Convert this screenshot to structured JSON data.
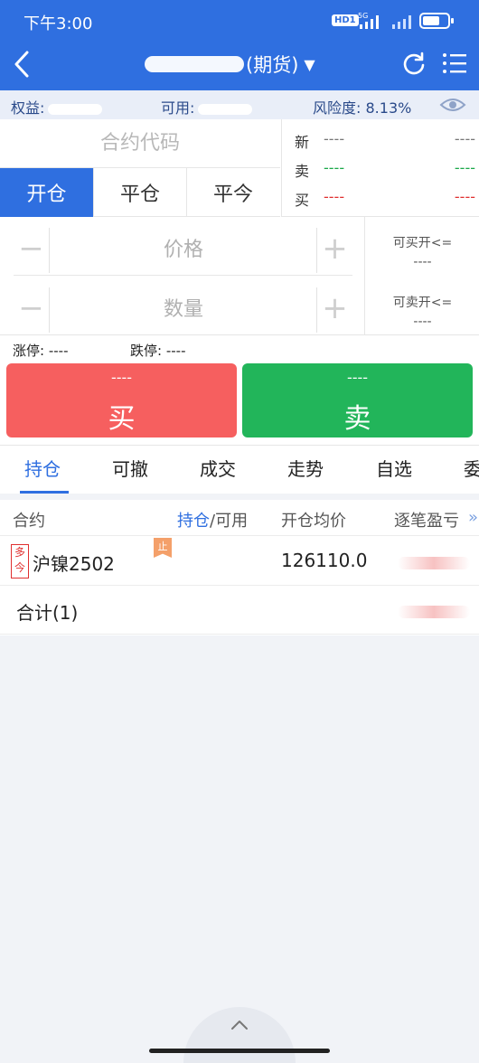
{
  "status": {
    "time": "下午3:00",
    "hd": "HD1",
    "net": "5G",
    "battery_level": 0.7
  },
  "header": {
    "title_suffix": "(期货)"
  },
  "account": {
    "equity_label": "权益:",
    "available_label": "可用:",
    "risk_label": "风险度:",
    "risk_value": "8.13%"
  },
  "order": {
    "code_placeholder": "合约代码",
    "tabs": [
      "开仓",
      "平仓",
      "平今"
    ],
    "price_placeholder": "价格",
    "qty_placeholder": "数量",
    "minus": "−",
    "plus": "+",
    "can_buy_label": "可买开<=",
    "can_buy_value": "----",
    "can_sell_label": "可卖开<=",
    "can_sell_value": "----",
    "limit_up_label": "涨停:",
    "limit_up_value": "----",
    "limit_down_label": "跌停:",
    "limit_down_value": "----",
    "buy_price": "----",
    "buy_label": "买",
    "sell_price": "----",
    "sell_label": "卖"
  },
  "quote": {
    "rows": [
      {
        "label": "新",
        "v1": "----",
        "v2": "----",
        "color": "gray"
      },
      {
        "label": "卖",
        "v1": "----",
        "v2": "----",
        "color": "green"
      },
      {
        "label": "买",
        "v1": "----",
        "v2": "----",
        "color": "red"
      }
    ]
  },
  "tabs": [
    "持仓",
    "可撤",
    "成交",
    "走势",
    "自选",
    "委"
  ],
  "positions": {
    "headers": {
      "contract": "合约",
      "holding": "持仓",
      "holding_sep": "/可用",
      "avg_price": "开仓均价",
      "pnl": "逐笔盈亏",
      "more": "»"
    },
    "rows": [
      {
        "side_1": "多",
        "side_2": "今",
        "stop": "止",
        "contract": "沪镍2502",
        "avg_price": "126110.0"
      }
    ],
    "total_label": "合计(1)"
  }
}
